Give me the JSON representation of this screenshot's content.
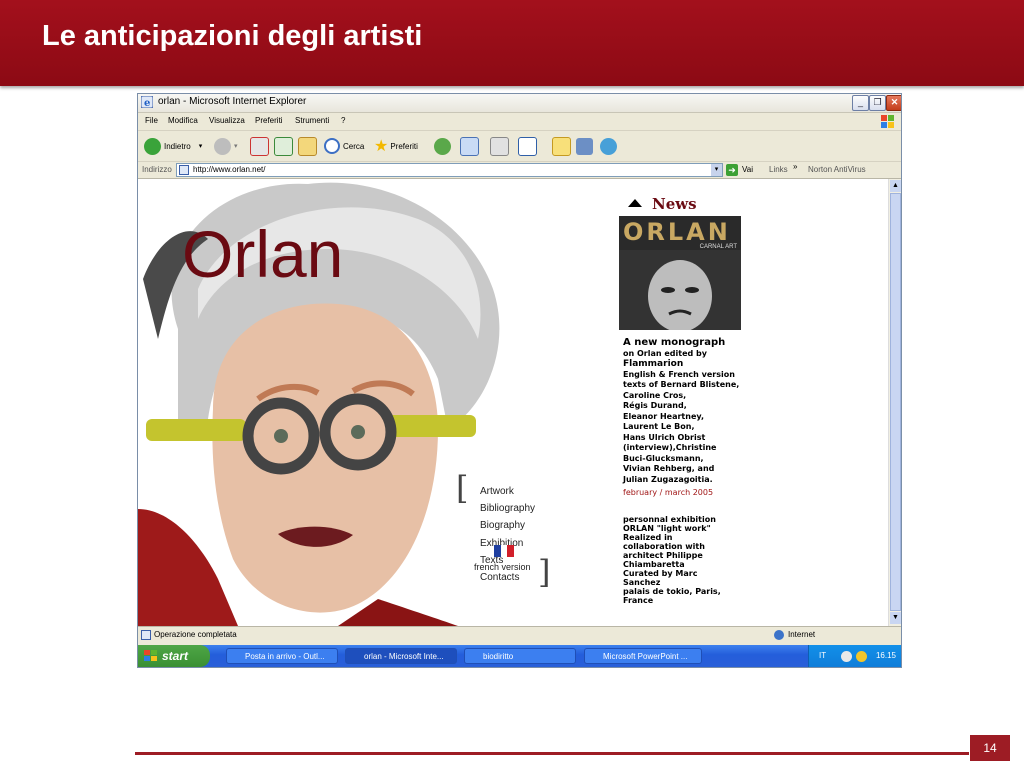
{
  "slide": {
    "title": "Le anticipazioni degli artisti",
    "page_number": "14",
    "accent_color": "#9d1c24"
  },
  "browser": {
    "window_title": "orlan - Microsoft Internet Explorer",
    "menu": [
      "File",
      "Modifica",
      "Visualizza",
      "Preferiti",
      "Strumenti",
      "?"
    ],
    "toolbar": {
      "back_label": "Indietro",
      "search_label": "Cerca",
      "favorites_label": "Preferiti"
    },
    "address": {
      "label": "Indirizzo",
      "url": "http://www.orlan.net/",
      "go_label": "Vai",
      "links_label": "Links",
      "antivirus_label": "Norton AntiVirus"
    },
    "status": {
      "text": "Operazione completata",
      "zone": "Internet"
    }
  },
  "site": {
    "logo": "Orlan",
    "nav": [
      "Artwork",
      "Bibliography",
      "Biography",
      "Exhibition",
      "Texts",
      "Contacts"
    ],
    "french_version": "french version",
    "news_title": "News",
    "book_title": "ORLAN",
    "book_subtitle": "CARNAL ART",
    "news": {
      "headline": "A new monograph",
      "line1": "on Orlan edited by",
      "publisher": "Flammarion",
      "contributors": [
        "English & French version",
        "texts of Bernard Blistene,",
        "Caroline Cros,",
        "Régis Durand,",
        "Eleanor Heartney,",
        "Laurent Le Bon,",
        "Hans Ulrich Obrist",
        "(interview),Christine",
        "Buci-Glucksmann,",
        "Vivian Rehberg, and",
        "Julian Zugazagoitia."
      ],
      "date": "february / march 2005",
      "exhibition": [
        "personnal exhibition",
        "ORLAN  \"light work\"",
        "Realized in",
        "collaboration with",
        "architect Philippe",
        "Chiambaretta",
        "Curated by Marc",
        "Sanchez",
        "palais de tokio, Paris,",
        "France"
      ]
    }
  },
  "taskbar": {
    "start_label": "start",
    "tasks": [
      "Posta in arrivo - Outl...",
      "orlan - Microsoft Inte...",
      "biodiritto",
      "Microsoft PowerPoint ..."
    ],
    "lang": "IT",
    "clock": "16.15"
  }
}
